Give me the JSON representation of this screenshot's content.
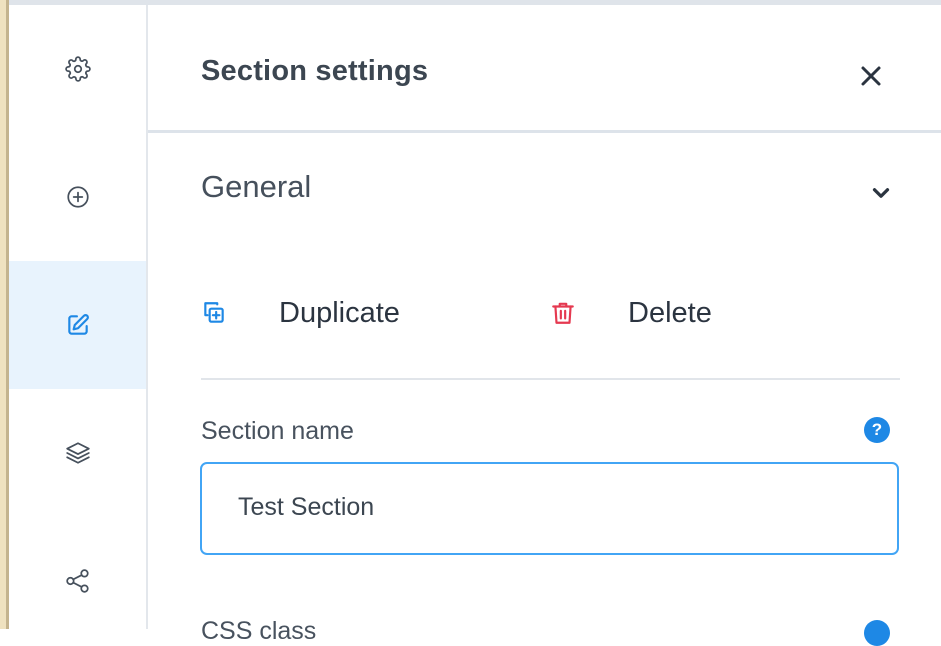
{
  "panel": {
    "title": "Section settings",
    "section_heading": "General",
    "actions": {
      "duplicate_label": "Duplicate",
      "delete_label": "Delete"
    },
    "section_name": {
      "label": "Section name",
      "value": "Test Section",
      "help": "?"
    },
    "next_field": {
      "label": "CSS class"
    }
  },
  "rail": {
    "items": [
      {
        "icon": "gear-icon",
        "active": false
      },
      {
        "icon": "plus-circle-icon",
        "active": false
      },
      {
        "icon": "edit-icon",
        "active": true
      },
      {
        "icon": "layers-icon",
        "active": false
      },
      {
        "icon": "share-icon",
        "active": false
      }
    ]
  },
  "colors": {
    "accent": "#1e88e5",
    "active_bg": "#e8f3fd",
    "delete": "#e53950",
    "text": "#2b3440"
  }
}
